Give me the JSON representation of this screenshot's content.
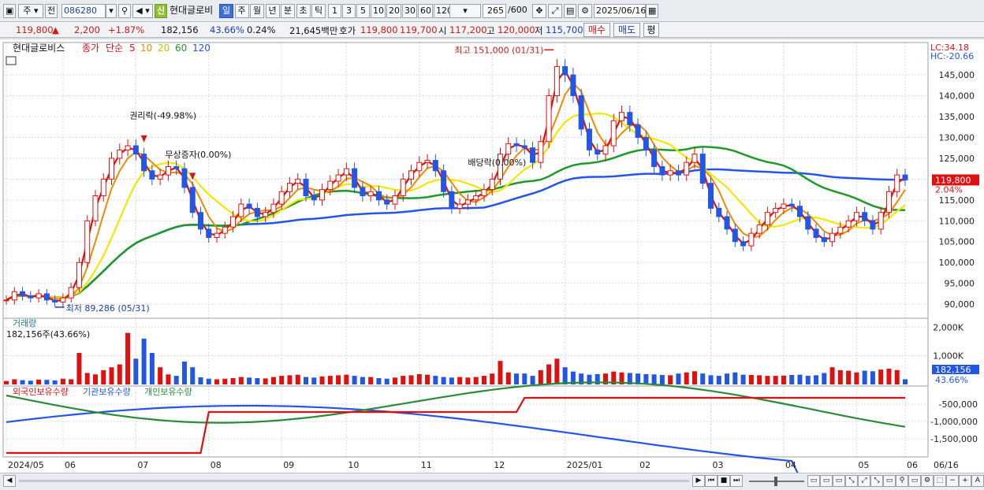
{
  "toolbar": {
    "tab_main": "주",
    "tab_prev": "전",
    "stock_code": "086280",
    "new_badge": "신",
    "stock_name": "현대글로비",
    "periods": [
      "일",
      "주",
      "월",
      "년",
      "분",
      "초",
      "틱"
    ],
    "selected_period": "일",
    "intervals": [
      "1",
      "3",
      "5",
      "10",
      "20",
      "30",
      "60",
      "120"
    ],
    "count": "265",
    "count_total": "/600",
    "date": "2025/06/16"
  },
  "quote": {
    "price": "119,800",
    "arrow": "▲",
    "change": "2,200",
    "change_pct": "+1.87%",
    "volume": "182,156",
    "volume_ratio": "43.66%",
    "turnover": "0.24%",
    "amount": "21,645백만",
    "hoga_label": "호가",
    "bid1": "119,800",
    "bid2": "119,700",
    "open_label": "시",
    "open": "117,200",
    "high_label": "고",
    "high": "120,000",
    "low_label": "저",
    "low": "115,700",
    "buy_button": "매수",
    "sell_button": "매도",
    "eval_button": "평"
  },
  "colors": {
    "ma5": "#e01010",
    "ma10": "#f08a00",
    "ma20": "#f5e600",
    "ma60": "#1f9a2a",
    "ma120": "#2456e6",
    "foreign": "#e01010",
    "institution": "#2a8a3a",
    "individual": "#2456e6"
  },
  "chart_data": [
    {
      "type": "line",
      "title": "현대글로비스",
      "legend": [
        "종가",
        "단순",
        "5",
        "10",
        "20",
        "60",
        "120"
      ],
      "legend_placement": "top-left",
      "x_ticks": [
        "2024/05",
        "06",
        "07",
        "08",
        "09",
        "10",
        "11",
        "12",
        "2025/01",
        "02",
        "03",
        "04",
        "05",
        "06",
        "06/16"
      ],
      "ylim": [
        87000,
        152000
      ],
      "y_ticks": [
        "145,000",
        "140,000",
        "135,000",
        "130,000",
        "125,000",
        "120,000",
        "115,000",
        "110,000",
        "105,000",
        "100,000",
        "95,000",
        "90,000"
      ],
      "price_scale_top": [
        "LC:34.18",
        "HC:-20.66"
      ],
      "current_price_label": "119,800",
      "current_change_label": "2.04%",
      "annotations": {
        "high": "최고 151,000 (01/31)",
        "low": "최저 89,286 (05/31)",
        "rights_ex": "권리락(-49.98%)",
        "bonus_issue": "무상증자(0.00%)",
        "dividend_ex": "배당락(0.00%)"
      },
      "grid": true,
      "series": [
        {
          "name": "종가",
          "values": [
            91000,
            93000,
            92000,
            91500,
            92500,
            91000,
            90500,
            91500,
            94000,
            100000,
            110000,
            116000,
            120000,
            125000,
            127000,
            128000,
            126000,
            122000,
            120000,
            121000,
            123000,
            122500,
            118000,
            112000,
            108000,
            106000,
            107000,
            108500,
            111000,
            114000,
            113000,
            111000,
            112000,
            114000,
            117000,
            119000,
            120000,
            116000,
            115000,
            117500,
            119500,
            121000,
            122500,
            118000,
            116000,
            117000,
            115000,
            114000,
            116000,
            120000,
            122000,
            124000,
            124500,
            122000,
            117000,
            113000,
            114000,
            115000,
            116000,
            117500,
            120000,
            126000,
            128500,
            128000,
            127500,
            124000,
            129000,
            140000,
            147000,
            145000,
            140000,
            132000,
            127000,
            126000,
            128000,
            134000,
            136000,
            133000,
            130000,
            127000,
            123000,
            121000,
            122000,
            121000,
            124000,
            126000,
            119000,
            113000,
            111000,
            108000,
            105000,
            104000,
            107000,
            109000,
            112000,
            113000,
            114000,
            113500,
            111000,
            108000,
            106000,
            105000,
            107000,
            108500,
            110000,
            112000,
            110000,
            108000,
            112000,
            117000,
            121000,
            119800
          ]
        },
        {
          "name": "5"
        },
        {
          "name": "10"
        },
        {
          "name": "20"
        },
        {
          "name": "60"
        },
        {
          "name": "120"
        }
      ]
    },
    {
      "type": "bar",
      "title": "거래량",
      "current_label": "182,156주(43.66%)",
      "y_ticks": [
        "2,000K",
        "1,000K"
      ],
      "ylim": [
        0,
        2200000
      ],
      "current_value_label": "182,156",
      "current_ratio_label": "43.66%",
      "values_k": [
        120,
        180,
        150,
        130,
        170,
        160,
        140,
        200,
        180,
        1100,
        400,
        350,
        500,
        600,
        700,
        1800,
        900,
        1600,
        1100,
        600,
        350,
        300,
        800,
        600,
        250,
        200,
        180,
        200,
        220,
        260,
        240,
        220,
        210,
        260,
        300,
        320,
        340,
        260,
        240,
        280,
        300,
        320,
        340,
        300,
        260,
        260,
        220,
        200,
        240,
        300,
        320,
        360,
        340,
        300,
        260,
        240,
        260,
        240,
        260,
        300,
        380,
        820,
        420,
        380,
        380,
        300,
        500,
        700,
        900,
        600,
        450,
        380,
        340,
        360,
        380,
        450,
        420,
        400,
        380,
        360,
        350,
        330,
        320,
        380,
        420,
        460,
        380,
        320,
        300,
        380,
        420,
        340,
        330,
        320,
        300,
        300,
        310,
        330,
        340,
        300,
        320,
        400,
        600,
        500,
        480,
        420,
        480,
        460,
        520,
        550,
        500,
        182
      ]
    },
    {
      "type": "line",
      "title": "외국인보유수량 · 기관보유수량 · 개인보유수량",
      "y_ticks": [
        "-500,000",
        "-1,000,000",
        "-1,500,000"
      ],
      "series": [
        {
          "name": "외국인보유수량"
        },
        {
          "name": "기관보유수량"
        },
        {
          "name": "개인보유수량"
        }
      ]
    }
  ],
  "bottom_icons": [
    "scroll-left-icon",
    "scroll-right-icon",
    "first-icon",
    "stop-icon",
    "last-icon",
    "zoom-slider-icon",
    "settings-icon",
    "zoom-out-icon",
    "zoom-in-icon",
    "font-icon"
  ]
}
